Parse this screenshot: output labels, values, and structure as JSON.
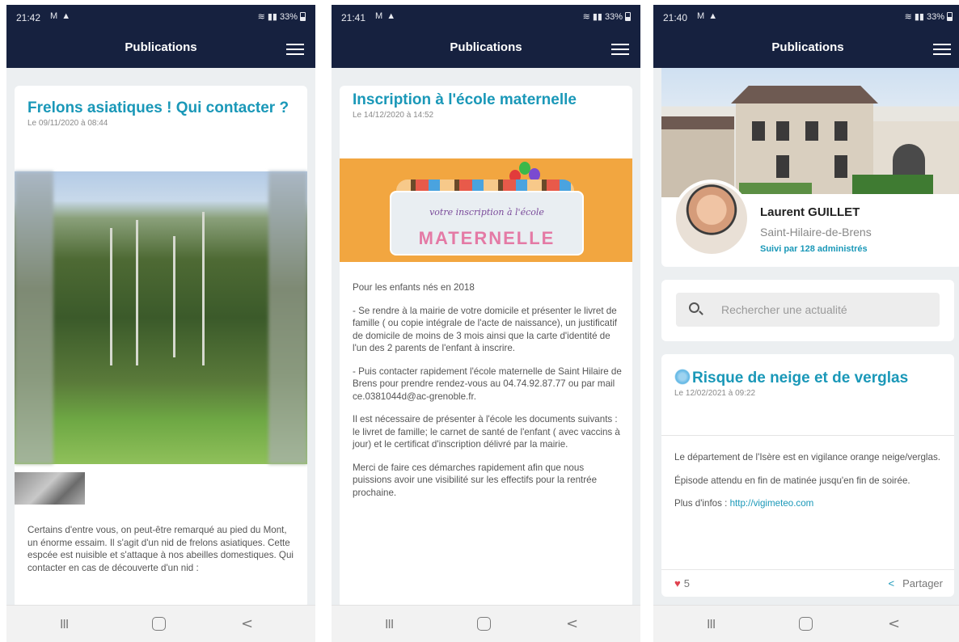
{
  "screens": [
    {
      "status": {
        "time": "21:42",
        "notif": "M ▲",
        "battery": "33%"
      },
      "title": "Publications",
      "post": {
        "title": "Frelons asiatiques ! Qui contacter ?",
        "date": "Le 09/11/2020 à 08:44",
        "body": [
          "Certains d'entre vous, on peut-être remarqué au pied du Mont, un énorme essaim. Il s'agit d'un nid de frelons asiatiques. Cette espcée est nuisible et s'attaque à nos abeilles domestiques. Qui contacter en cas de découverte d'un nid :"
        ]
      },
      "nav": {
        "recents": "III",
        "back": "<"
      }
    },
    {
      "status": {
        "time": "21:41",
        "notif": "M ▲",
        "battery": "33%"
      },
      "title": "Publications",
      "post": {
        "title": "Inscription à l'école maternelle",
        "date": "Le 14/12/2020 à 14:52",
        "banner_line1": "votre inscription à l'école",
        "banner_line2": "MATERNELLE",
        "body": [
          "Pour les enfants nés en 2018",
          "- Se rendre à la mairie de votre domicile et présenter le livret de famille ( ou copie intégrale de l'acte de naissance), un justificatif de domicile de moins de 3 mois ainsi que la carte d'identité de l'un des 2 parents de l'enfant à inscrire.",
          "- Puis contacter rapidement l'école maternelle de Saint Hilaire de Brens pour prendre rendez-vous au 04.74.92.87.77 ou par mail ce.0381044d@ac-grenoble.fr.",
          "Il est nécessaire de présenter à l'école les documents suivants : le livret de famille; le carnet de santé de l'enfant ( avec vaccins à jour) et le certificat d'inscription délivré par la mairie.",
          "Merci de faire ces démarches rapidement afin que nous puissions avoir une visibilité sur les effectifs pour la rentrée prochaine."
        ]
      },
      "nav": {
        "recents": "III",
        "back": "<"
      }
    },
    {
      "status": {
        "time": "21:40",
        "notif": "M ▲",
        "battery": "33%"
      },
      "title": "Publications",
      "profile": {
        "name": "Laurent GUILLET",
        "place": "Saint-Hilaire-de-Brens",
        "followers": "Suivi par 128 administrés"
      },
      "search": {
        "placeholder": "Rechercher une actualité"
      },
      "post": {
        "title": "Risque de neige et de verglas",
        "date": "Le 12/02/2021 à 09:22",
        "body": [
          "Le département de l'Isère est en vigilance orange neige/verglas.",
          "Épisode attendu en fin de matinée jusqu'en fin de soirée."
        ],
        "more_label": "Plus d'infos : ",
        "more_link": "http://vigimeteo.com",
        "likes": "5",
        "share": "Partager"
      },
      "nav": {
        "recents": "III",
        "back": "<"
      }
    }
  ],
  "colors": {
    "header": "#16213f",
    "accent": "#1a98b8",
    "heart": "#e0414e"
  },
  "icons": [
    "menu-icon",
    "search-icon",
    "snowflake-icon",
    "heart-icon",
    "share-icon",
    "recents-icon",
    "home-icon",
    "back-icon",
    "battery-icon"
  ]
}
